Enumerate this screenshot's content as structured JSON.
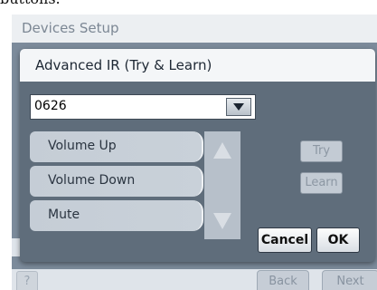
{
  "caption_cropped": "buttons.",
  "window": {
    "title": "Devices Setup"
  },
  "dialog": {
    "title": "Advanced IR (Try & Learn)",
    "combo_value": "0626",
    "list_items": [
      "Volume Up",
      "Volume Down",
      "Mute"
    ],
    "try_label": "Try",
    "learn_label": "Learn",
    "cancel_label": "Cancel",
    "ok_label": "OK"
  },
  "bottom": {
    "help_label": "?",
    "back_label": "Back",
    "next_label": "Next"
  },
  "icons": {
    "dropdown": "chevron-down-icon",
    "scroll_up": "triangle-up-icon",
    "scroll_down": "triangle-down-icon"
  },
  "colors": {
    "panel": "#7c8b9b",
    "dialog_bg": "#5f6d7b",
    "list_item": "#c9d1d9",
    "disabled_text": "#8c97a3"
  }
}
